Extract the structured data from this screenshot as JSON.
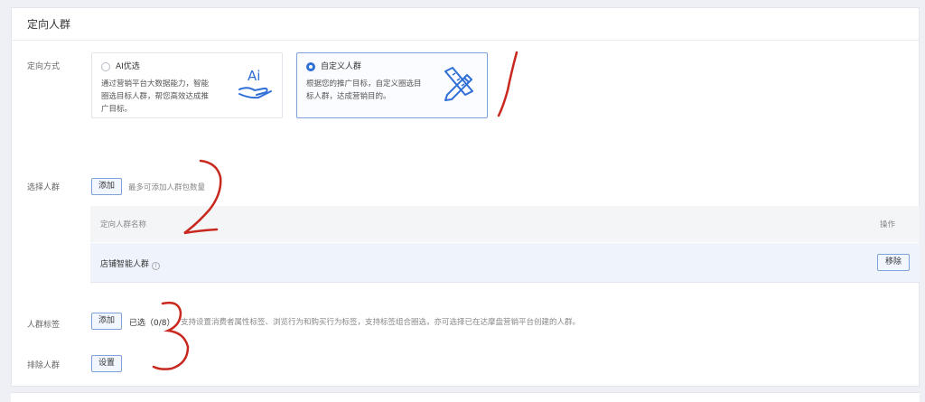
{
  "section_title": "定向人群",
  "targeting_method": {
    "label": "定向方式",
    "options": [
      {
        "title": "AI优选",
        "desc_lines": [
          "通过营销平台大数据能力，智能",
          "圈选目标人群，帮您高效达成推",
          "广目标。"
        ],
        "selected": false,
        "icon": "ai-hand-icon"
      },
      {
        "title": "自定义人群",
        "desc_lines": [
          "根据您的推广目标，自定义圈选目",
          "标人群，达成营销目的。"
        ],
        "selected": true,
        "icon": "pencil-ruler-icon"
      }
    ]
  },
  "crowd_rows": {
    "label": "选择人群",
    "add_label": "添加",
    "hint": "最多可添加人群包数量",
    "columns": [
      "定向人群名称",
      "操作"
    ],
    "rows": [
      {
        "name": "店铺智能人群",
        "action": "移除"
      }
    ]
  },
  "tag_targeting": {
    "label": "人群标签",
    "add_label": "添加",
    "selected_text": "已选（0/8）",
    "desc": "支持设置消费者属性标签、浏览行为和购买行为标签，支持标签组合圈选，亦可选择已在达摩盘营销平台创建的人群。"
  },
  "exclude_targeting": {
    "label": "排除人群",
    "set_label": "设置"
  },
  "annotations": {
    "color": "#c8281e",
    "numbers": [
      "1",
      "2",
      "3"
    ]
  },
  "colors": {
    "accent": "#2f6fd6",
    "row_highlight": "#eef3fc"
  }
}
